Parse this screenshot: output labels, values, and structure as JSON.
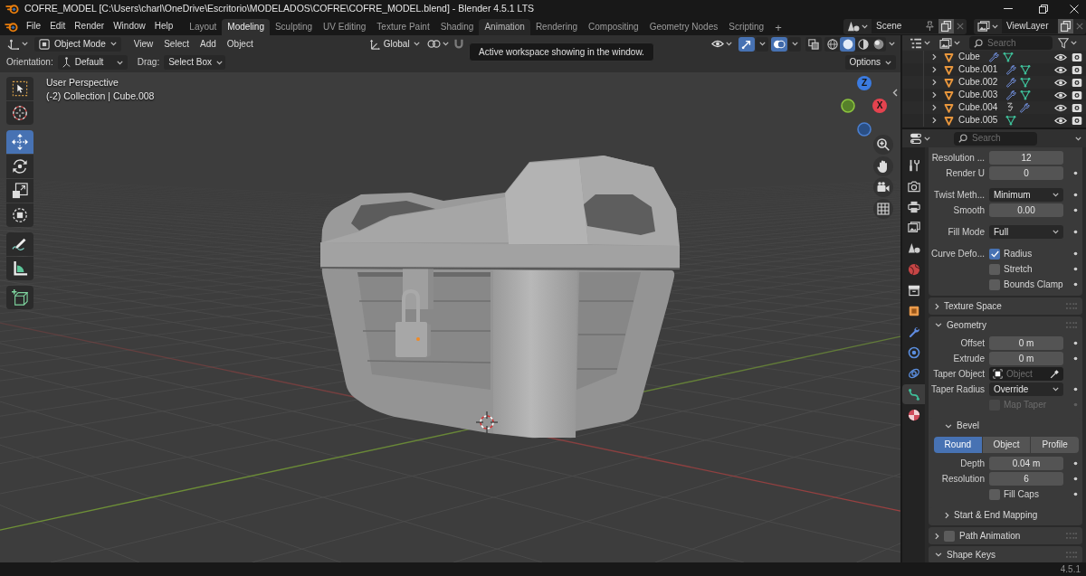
{
  "window": {
    "title": "COFRE_MODEL [C:\\Users\\charl\\OneDrive\\Escritorio\\MODELADOS\\COFRE\\COFRE_MODEL.blend] - Blender 4.5.1 LTS"
  },
  "menu": [
    "File",
    "Edit",
    "Render",
    "Window",
    "Help"
  ],
  "workspaces": [
    {
      "label": "Layout",
      "selected": false,
      "hovered": false
    },
    {
      "label": "Modeling",
      "selected": true,
      "hovered": false
    },
    {
      "label": "Sculpting",
      "selected": false,
      "hovered": false
    },
    {
      "label": "UV Editing",
      "selected": false,
      "hovered": false
    },
    {
      "label": "Texture Paint",
      "selected": false,
      "hovered": false
    },
    {
      "label": "Shading",
      "selected": false,
      "hovered": false
    },
    {
      "label": "Animation",
      "selected": false,
      "hovered": true
    },
    {
      "label": "Rendering",
      "selected": false,
      "hovered": false
    },
    {
      "label": "Compositing",
      "selected": false,
      "hovered": false
    },
    {
      "label": "Geometry Nodes",
      "selected": false,
      "hovered": false
    },
    {
      "label": "Scripting",
      "selected": false,
      "hovered": false
    }
  ],
  "add_workspace": "+",
  "scene": "Scene",
  "view_layer": "ViewLayer",
  "viewport_header": {
    "mode": "Object Mode",
    "menus": [
      "View",
      "Select",
      "Add",
      "Object"
    ],
    "orientation": "Global",
    "gizmos": true,
    "overlays": true,
    "xray": false,
    "shading": [
      {
        "kind": "wireframe",
        "selected": false
      },
      {
        "kind": "solid",
        "selected": true
      },
      {
        "kind": "material",
        "selected": false
      },
      {
        "kind": "rendered",
        "selected": false
      }
    ]
  },
  "tooltip": "Active workspace showing in the window.",
  "tool_settings": {
    "orientation_label": "Orientation:",
    "orientation": "Default",
    "drag_label": "Drag:",
    "drag": "Select Box",
    "options": "Options"
  },
  "tools": [
    [
      {
        "kind": "select_box",
        "selected": false
      },
      {
        "kind": "cursor",
        "selected": false
      }
    ],
    [
      {
        "kind": "move",
        "selected": true
      },
      {
        "kind": "rotate",
        "selected": false
      },
      {
        "kind": "scale",
        "selected": false
      },
      {
        "kind": "transform",
        "selected": false
      }
    ],
    [
      {
        "kind": "annotate",
        "selected": false
      },
      {
        "kind": "measure",
        "selected": false
      }
    ],
    [
      {
        "kind": "add_cube",
        "selected": false
      }
    ]
  ],
  "viewport": {
    "view": "User Perspective",
    "context": "(-2) Collection | Cube.008",
    "gizmo": [
      {
        "kind": "z",
        "label": "Z"
      },
      {
        "kind": "x",
        "label": "X"
      }
    ]
  },
  "outliner": {
    "search_placeholder": "Search",
    "items": [
      {
        "name": "Cube",
        "expanded": false,
        "badges": [
          {
            "kind": "modifier"
          },
          {
            "kind": "mesh"
          }
        ]
      },
      {
        "name": "Cube.001",
        "expanded": false,
        "badges": [
          {
            "kind": "modifier"
          },
          {
            "kind": "mesh"
          }
        ]
      },
      {
        "name": "Cube.002",
        "expanded": false,
        "badges": [
          {
            "kind": "modifier"
          },
          {
            "kind": "mesh"
          }
        ]
      },
      {
        "name": "Cube.003",
        "expanded": false,
        "badges": [
          {
            "kind": "modifier"
          },
          {
            "kind": "mesh"
          }
        ]
      },
      {
        "name": "Cube.004",
        "expanded": false,
        "badges": [
          {
            "kind": "constraint"
          },
          {
            "kind": "modifier"
          }
        ]
      },
      {
        "name": "Cube.005",
        "expanded": false,
        "badges": [
          {
            "kind": "mesh"
          }
        ]
      }
    ]
  },
  "properties": {
    "search_placeholder": "Search",
    "tabs": [
      {
        "kind": "tool",
        "selected": false
      },
      {
        "kind": "render",
        "selected": false
      },
      {
        "kind": "output",
        "selected": false
      },
      {
        "kind": "view_layer",
        "selected": false
      },
      {
        "kind": "scene",
        "selected": false
      },
      {
        "kind": "world",
        "selected": false
      },
      {
        "kind": "collection",
        "selected": false
      },
      {
        "kind": "object",
        "selected": false
      },
      {
        "kind": "modifiers",
        "selected": false
      },
      {
        "kind": "physics",
        "selected": false
      },
      {
        "kind": "constraints",
        "selected": false
      },
      {
        "kind": "data",
        "selected": true
      },
      {
        "kind": "material",
        "selected": false
      }
    ],
    "groups": [
      [
        {
          "kind": "number",
          "label": "Resolution ...",
          "value": "12",
          "keyframe": false,
          "disabled": false
        },
        {
          "kind": "number",
          "label": "Render U",
          "value": "0",
          "keyframe": true,
          "disabled": false
        }
      ],
      [
        {
          "kind": "dropdown",
          "label": "Twist Meth...",
          "value": "Minimum",
          "keyframe": true,
          "disabled": false
        },
        {
          "kind": "number",
          "label": "Smooth",
          "value": "0.00",
          "keyframe": true,
          "disabled": false
        }
      ],
      [
        {
          "kind": "dropdown",
          "label": "Fill Mode",
          "value": "Full",
          "keyframe": true,
          "disabled": false
        }
      ],
      [
        {
          "kind": "checkbox",
          "label": "Curve Defo...",
          "text": "Radius",
          "checked": true,
          "keyframe": true,
          "disabled": false
        },
        {
          "kind": "checkbox",
          "text": "Stretch",
          "checked": false,
          "keyframe": true,
          "disabled": false
        },
        {
          "kind": "checkbox",
          "text": "Bounds Clamp",
          "checked": false,
          "keyframe": true,
          "disabled": false
        }
      ]
    ],
    "panels": [
      {
        "title": "Texture Space",
        "expanded": false
      },
      {
        "title": "Geometry",
        "expanded": true,
        "groups": [
          [
            {
              "kind": "number",
              "label": "Offset",
              "value": "0 m",
              "keyframe": true,
              "disabled": false
            },
            {
              "kind": "number",
              "label": "Extrude",
              "value": "0 m",
              "keyframe": true,
              "disabled": false
            },
            {
              "kind": "object",
              "label": "Taper Object",
              "placeholder": "Object",
              "keyframe": false,
              "disabled": false
            },
            {
              "kind": "dropdown",
              "label": "Taper Radius",
              "value": "Override",
              "keyframe": true,
              "disabled": false
            },
            {
              "kind": "checkbox",
              "text": "Map Taper",
              "checked": false,
              "keyframe": true,
              "disabled": true
            }
          ]
        ],
        "subpanels": [
          {
            "title": "Bevel",
            "expanded": true,
            "modes": [
              {
                "label": "Round",
                "selected": true
              },
              {
                "label": "Object",
                "selected": false
              },
              {
                "label": "Profile",
                "selected": false
              }
            ],
            "groups": [
              [
                {
                  "kind": "number",
                  "label": "Depth",
                  "value": "0.04 m",
                  "keyframe": true,
                  "disabled": false
                },
                {
                  "kind": "number",
                  "label": "Resolution",
                  "value": "6",
                  "keyframe": true,
                  "disabled": false
                },
                {
                  "kind": "checkbox",
                  "text": "Fill Caps",
                  "checked": false,
                  "keyframe": true,
                  "disabled": false
                }
              ]
            ]
          },
          {
            "title": "Start & End Mapping",
            "expanded": false
          }
        ]
      },
      {
        "title": "Path Animation",
        "expanded": false,
        "checkbox": {
          "checked": false
        }
      },
      {
        "title": "Shape Keys",
        "expanded": true
      }
    ]
  },
  "status_bar": {
    "version": "4.5.1"
  }
}
